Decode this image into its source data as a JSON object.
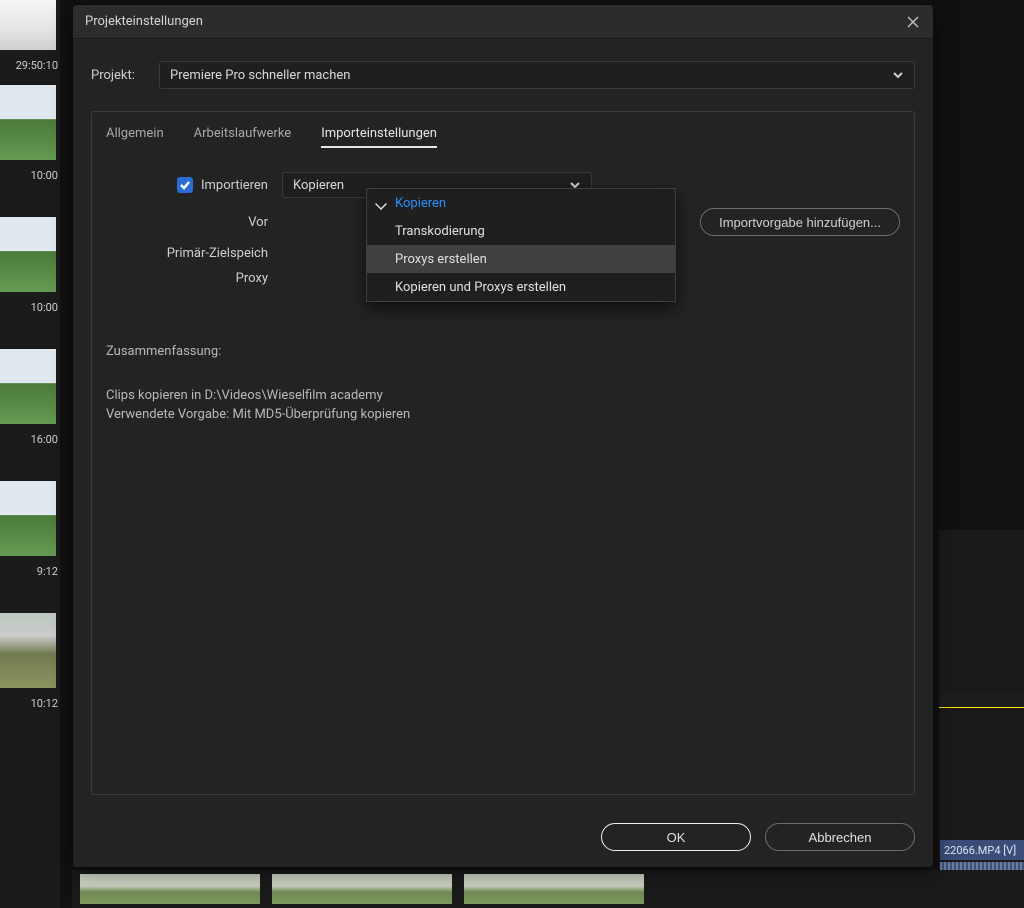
{
  "thumbs": [
    {
      "label": "29:50:10"
    },
    {
      "label": "10:00"
    },
    {
      "label": "10:00"
    },
    {
      "label": "16:00"
    },
    {
      "label": "9:12"
    },
    {
      "label": "10:12"
    }
  ],
  "clip_chip": "22066.MP4 [V]",
  "modal": {
    "title": "Projekteinstellungen",
    "close_aria": "Schließen"
  },
  "project_row": {
    "label": "Projekt:",
    "value": "Premiere Pro schneller machen"
  },
  "tabs": {
    "general": "Allgemein",
    "scratch": "Arbeitslaufwerke",
    "import": "Importeinstellungen"
  },
  "form": {
    "import_checkbox_label": "Importieren",
    "import_select_value": "Kopieren",
    "preset_label_partial": "Vor",
    "dest_label_partial": "Primär-Zielspeich",
    "proxy_label_partial": "Proxy",
    "add_preset_button": "Importvorgabe hinzufügen..."
  },
  "dropdown": {
    "items": [
      "Kopieren",
      "Transkodierung",
      "Proxys erstellen",
      "Kopieren und Proxys erstellen"
    ],
    "selected_index": 0,
    "hover_index": 2
  },
  "summary": {
    "heading": "Zusammenfassung:",
    "line1": "Clips kopieren in D:\\Videos\\Wieselfilm academy",
    "line2": "Verwendete Vorgabe: Mit MD5-Überprüfung kopieren"
  },
  "buttons": {
    "ok": "OK",
    "cancel": "Abbrechen"
  }
}
